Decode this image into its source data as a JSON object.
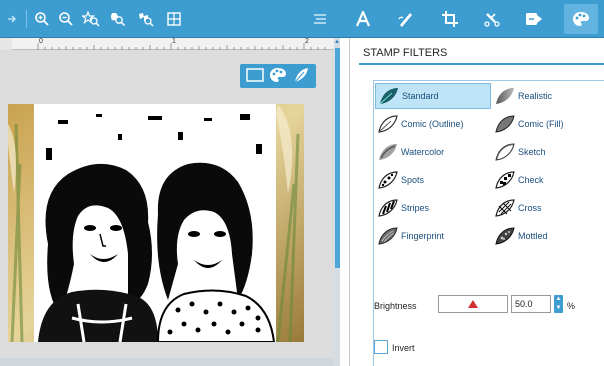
{
  "toolbar": {
    "tools": [
      {
        "icon": "arrow-icon"
      },
      {
        "icon": "zoom-in-icon"
      },
      {
        "icon": "zoom-out-icon"
      },
      {
        "icon": "zoom-fit-icon"
      },
      {
        "icon": "zoom-selection-icon"
      },
      {
        "icon": "pan-icon"
      },
      {
        "icon": "grid-icon"
      },
      {
        "icon": "align-icon"
      },
      {
        "icon": "text-icon"
      },
      {
        "icon": "draw-icon"
      },
      {
        "icon": "crop-icon"
      },
      {
        "icon": "knife-icon"
      },
      {
        "icon": "trace-icon"
      },
      {
        "icon": "palette-icon"
      }
    ],
    "accent": "#3d9dd0"
  },
  "ruler": {
    "numbers": [
      "0",
      "1",
      "2"
    ]
  },
  "mini_tools": [
    {
      "icon": "rectangle-icon"
    },
    {
      "icon": "palette-icon"
    },
    {
      "icon": "feather-icon"
    }
  ],
  "panel": {
    "title": "STAMP FILTERS",
    "filters": [
      {
        "label": "Standard",
        "selected": true
      },
      {
        "label": "Realistic"
      },
      {
        "label": "Comic (Outline)"
      },
      {
        "label": "Comic (Fill)"
      },
      {
        "label": "Watercolor"
      },
      {
        "label": "Sketch"
      },
      {
        "label": "Spots"
      },
      {
        "label": "Check"
      },
      {
        "label": "Stripes"
      },
      {
        "label": "Cross"
      },
      {
        "label": "Fingerprint"
      },
      {
        "label": "Mottled"
      }
    ],
    "brightness": {
      "label": "Brightness",
      "value": "50.0",
      "unit": "%",
      "level": 0.5
    },
    "invert": {
      "label": "Invert",
      "checked": false
    }
  }
}
